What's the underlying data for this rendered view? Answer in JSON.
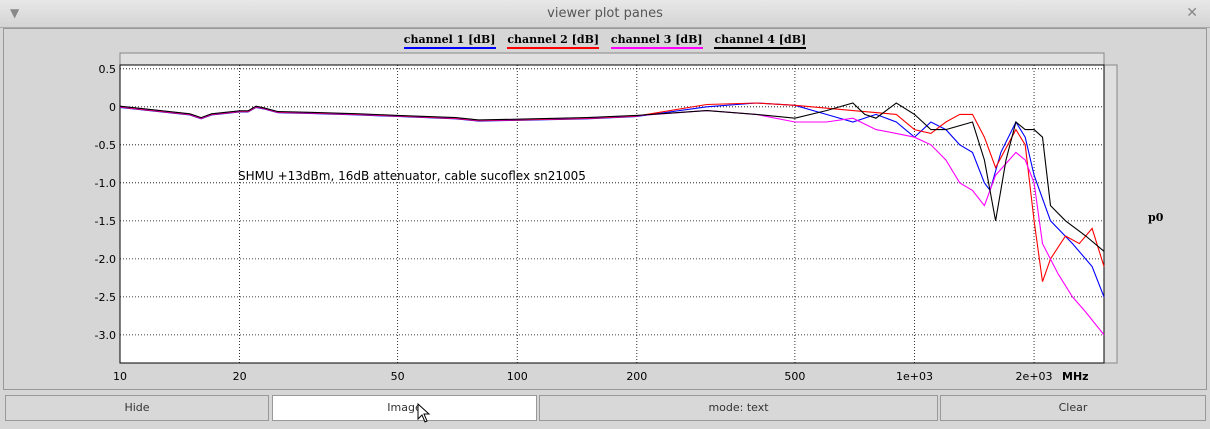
{
  "window": {
    "title": "viewer plot panes",
    "menu_icon": "triangle-down-icon",
    "close_icon": "close-icon"
  },
  "legend": [
    {
      "label": "channel 1 [dB]",
      "color": "#0000ff"
    },
    {
      "label": "channel 2 [dB]",
      "color": "#ff0000"
    },
    {
      "label": "channel 3 [dB]",
      "color": "#ff00ff"
    },
    {
      "label": "channel 4 [dB]",
      "color": "#000000"
    }
  ],
  "side_label": "p0",
  "buttons": {
    "hide": "Hide",
    "image": "Image",
    "mode": "mode: text",
    "clear": "Clear"
  },
  "chart_data": {
    "type": "line",
    "xscale": "log",
    "xlabel": "MHz",
    "xlim": [
      10,
      3000
    ],
    "ylim": [
      -3.37,
      0.55
    ],
    "xticks": [
      {
        "v": 10,
        "l": "10"
      },
      {
        "v": 20,
        "l": "20"
      },
      {
        "v": 50,
        "l": "50"
      },
      {
        "v": 100,
        "l": "100"
      },
      {
        "v": 200,
        "l": "200"
      },
      {
        "v": 500,
        "l": "500"
      },
      {
        "v": 1000,
        "l": "1e+03"
      },
      {
        "v": 2000,
        "l": "2e+03"
      }
    ],
    "yticks": [
      {
        "v": 0.5,
        "l": "0.5"
      },
      {
        "v": 0,
        "l": "0"
      },
      {
        "v": -0.5,
        "l": "-0.5"
      },
      {
        "v": -1,
        "l": "-1.0"
      },
      {
        "v": -1.5,
        "l": "-1.5"
      },
      {
        "v": -2,
        "l": "-2.0"
      },
      {
        "v": -2.5,
        "l": "-2.5"
      },
      {
        "v": -3,
        "l": "-3.0"
      }
    ],
    "annotation": "SHMU +13dBm, 16dB attenuator, cable sucoflex sn21005",
    "common": [
      [
        10,
        0
      ],
      [
        15,
        -0.1
      ],
      [
        16,
        -0.15
      ],
      [
        17,
        -0.1
      ],
      [
        20,
        -0.06
      ],
      [
        21,
        -0.06
      ],
      [
        22,
        0
      ],
      [
        23,
        -0.02
      ],
      [
        25,
        -0.07
      ],
      [
        30,
        -0.08
      ],
      [
        40,
        -0.1
      ],
      [
        50,
        -0.12
      ],
      [
        70,
        -0.15
      ],
      [
        80,
        -0.18
      ],
      [
        100,
        -0.17
      ],
      [
        150,
        -0.15
      ],
      [
        200,
        -0.12
      ]
    ],
    "series": [
      {
        "name": "channel 1 [dB]",
        "color": "#0000ff",
        "points": [
          [
            300,
            0
          ],
          [
            400,
            0.05
          ],
          [
            500,
            0.02
          ],
          [
            600,
            -0.1
          ],
          [
            700,
            -0.2
          ],
          [
            800,
            -0.1
          ],
          [
            900,
            -0.2
          ],
          [
            1000,
            -0.4
          ],
          [
            1100,
            -0.2
          ],
          [
            1200,
            -0.3
          ],
          [
            1300,
            -0.5
          ],
          [
            1400,
            -0.6
          ],
          [
            1500,
            -1.0
          ],
          [
            1550,
            -1.1
          ],
          [
            1650,
            -0.6
          ],
          [
            1800,
            -0.2
          ],
          [
            1900,
            -0.4
          ],
          [
            2000,
            -0.9
          ],
          [
            2200,
            -1.5
          ],
          [
            2500,
            -1.8
          ],
          [
            2800,
            -2.1
          ],
          [
            3000,
            -2.5
          ]
        ]
      },
      {
        "name": "channel 2 [dB]",
        "color": "#ff0000",
        "points": [
          [
            300,
            0.03
          ],
          [
            400,
            0.05
          ],
          [
            500,
            0.02
          ],
          [
            700,
            -0.05
          ],
          [
            900,
            -0.1
          ],
          [
            1000,
            -0.3
          ],
          [
            1100,
            -0.35
          ],
          [
            1200,
            -0.2
          ],
          [
            1300,
            -0.1
          ],
          [
            1400,
            -0.1
          ],
          [
            1500,
            -0.4
          ],
          [
            1600,
            -0.8
          ],
          [
            1800,
            -0.3
          ],
          [
            1900,
            -0.5
          ],
          [
            2000,
            -1.5
          ],
          [
            2100,
            -2.3
          ],
          [
            2200,
            -2.0
          ],
          [
            2400,
            -1.7
          ],
          [
            2600,
            -1.8
          ],
          [
            2800,
            -1.6
          ],
          [
            3000,
            -2.1
          ]
        ]
      },
      {
        "name": "channel 3 [dB]",
        "color": "#ff00ff",
        "points": [
          [
            300,
            -0.05
          ],
          [
            400,
            -0.1
          ],
          [
            500,
            -0.2
          ],
          [
            600,
            -0.2
          ],
          [
            700,
            -0.15
          ],
          [
            800,
            -0.3
          ],
          [
            900,
            -0.35
          ],
          [
            1000,
            -0.4
          ],
          [
            1100,
            -0.5
          ],
          [
            1200,
            -0.7
          ],
          [
            1300,
            -1.0
          ],
          [
            1400,
            -1.1
          ],
          [
            1500,
            -1.3
          ],
          [
            1600,
            -0.9
          ],
          [
            1800,
            -0.6
          ],
          [
            1900,
            -0.7
          ],
          [
            2000,
            -1.0
          ],
          [
            2100,
            -1.8
          ],
          [
            2300,
            -2.2
          ],
          [
            2500,
            -2.5
          ],
          [
            2700,
            -2.7
          ],
          [
            3000,
            -3.0
          ]
        ]
      },
      {
        "name": "channel 4 [dB]",
        "color": "#000000",
        "points": [
          [
            300,
            -0.05
          ],
          [
            400,
            -0.1
          ],
          [
            500,
            -0.15
          ],
          [
            600,
            -0.05
          ],
          [
            700,
            0.05
          ],
          [
            750,
            -0.1
          ],
          [
            800,
            -0.15
          ],
          [
            900,
            0.05
          ],
          [
            1000,
            -0.1
          ],
          [
            1100,
            -0.3
          ],
          [
            1200,
            -0.3
          ],
          [
            1400,
            -0.2
          ],
          [
            1500,
            -0.7
          ],
          [
            1600,
            -1.5
          ],
          [
            1700,
            -0.7
          ],
          [
            1800,
            -0.2
          ],
          [
            1900,
            -0.3
          ],
          [
            2000,
            -0.3
          ],
          [
            2100,
            -0.4
          ],
          [
            2200,
            -1.3
          ],
          [
            2400,
            -1.5
          ],
          [
            2700,
            -1.7
          ],
          [
            3000,
            -1.9
          ]
        ]
      }
    ]
  }
}
